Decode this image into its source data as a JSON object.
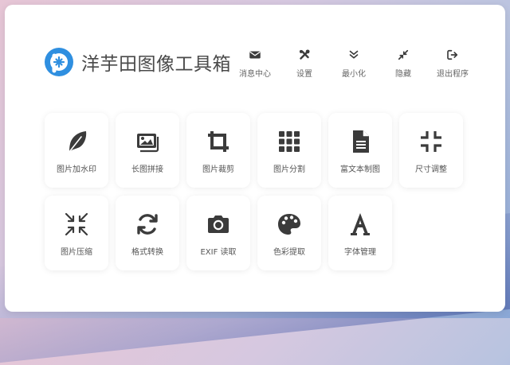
{
  "app": {
    "title": "洋芋田图像工具箱"
  },
  "toolbar": {
    "items": [
      {
        "label": "消息中心",
        "icon": "envelope-icon"
      },
      {
        "label": "设置",
        "icon": "tools-icon"
      },
      {
        "label": "最小化",
        "icon": "double-chevron-down-icon"
      },
      {
        "label": "隐藏",
        "icon": "collapse-arrows-icon"
      },
      {
        "label": "退出程序",
        "icon": "exit-icon"
      }
    ]
  },
  "tools": {
    "items": [
      {
        "label": "图片加水印",
        "icon": "feather-icon"
      },
      {
        "label": "长图拼接",
        "icon": "images-icon"
      },
      {
        "label": "图片裁剪",
        "icon": "crop-icon"
      },
      {
        "label": "图片分割",
        "icon": "grid-icon"
      },
      {
        "label": "富文本制图",
        "icon": "document-icon"
      },
      {
        "label": "尺寸调整",
        "icon": "compress-icon"
      },
      {
        "label": "图片压缩",
        "icon": "shrink-arrows-icon"
      },
      {
        "label": "格式转换",
        "icon": "sync-icon"
      },
      {
        "label": "EXIF 读取",
        "icon": "camera-icon"
      },
      {
        "label": "色彩提取",
        "icon": "palette-icon"
      },
      {
        "label": "字体管理",
        "icon": "font-icon"
      }
    ]
  },
  "colors": {
    "accent": "#2f8fe0",
    "icon": "#3b3b3b",
    "text": "#555555"
  }
}
